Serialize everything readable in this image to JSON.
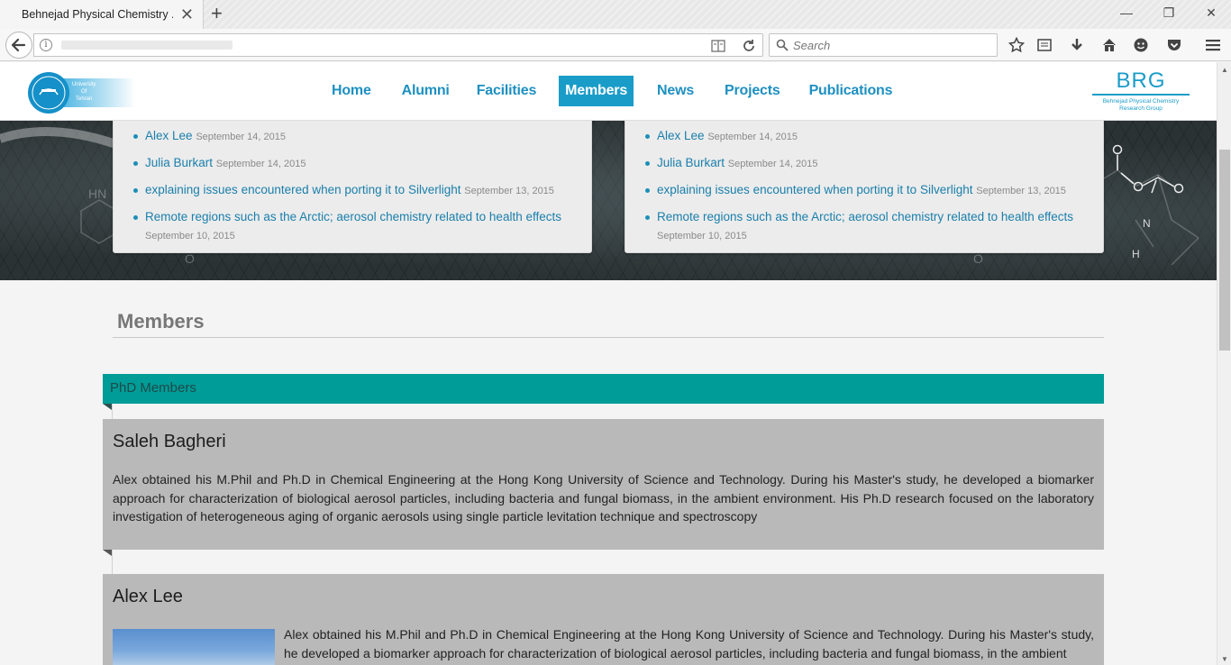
{
  "browser": {
    "tab_title": "Behnejad Physical Chemistry ...",
    "tab_close": "✕",
    "new_tab": "+",
    "url": "",
    "search_placeholder": "Search",
    "window": {
      "minimize": "—",
      "restore": "❐",
      "close": "✕"
    }
  },
  "header": {
    "logo_text": [
      "University",
      "Of",
      "Tehran"
    ],
    "nav": [
      "Home",
      "Alumni",
      "Facilities",
      "Members",
      "News",
      "Projects",
      "Publications"
    ],
    "active_nav": "Members",
    "brand_title": "BRG",
    "brand_subtitle_1": "Behnejad Physical Chemistry",
    "brand_subtitle_2": "Research Group"
  },
  "news_cards": [
    {
      "items": [
        {
          "title": "Alex Lee",
          "date": "September 14, 2015"
        },
        {
          "title": "Julia Burkart",
          "date": "September 14, 2015"
        },
        {
          "title": "explaining issues encountered when porting it to Silverlight",
          "date": "September 13, 2015"
        },
        {
          "title": "Remote regions such as the Arctic; aerosol chemistry related to health effects",
          "date": "September 10, 2015"
        }
      ]
    },
    {
      "items": [
        {
          "title": "Alex Lee",
          "date": "September 14, 2015"
        },
        {
          "title": "Julia Burkart",
          "date": "September 14, 2015"
        },
        {
          "title": "explaining issues encountered when porting it to Silverlight",
          "date": "September 13, 2015"
        },
        {
          "title": "Remote regions such as the Arctic; aerosol chemistry related to health effects",
          "date": "September 10, 2015"
        }
      ]
    }
  ],
  "members": {
    "section_title": "Members",
    "group_label": "PhD Members",
    "people": [
      {
        "name": "Saleh Bagheri",
        "bio": "Alex obtained his M.Phil and Ph.D in Chemical Engineering at the Hong Kong University of Science and Technology. During his Master's study, he developed a biomarker approach for characterization of biological aerosol particles, including bacteria and fungal biomass, in the ambient environment. His Ph.D research focused on the laboratory investigation of heterogeneous aging of organic aerosols using single particle levitation technique and spectroscopy"
      },
      {
        "name": "Alex Lee",
        "bio": "Alex obtained his M.Phil and Ph.D in Chemical Engineering at the Hong Kong University of Science and Technology. During his Master's study, he developed a biomarker approach for characterization of biological aerosol particles, including bacteria and fungal biomass, in the ambient"
      }
    ]
  },
  "colors": {
    "accent": "#1a9cc9",
    "teal_bar": "#009c97",
    "card_gray": "#b9b9b9"
  }
}
